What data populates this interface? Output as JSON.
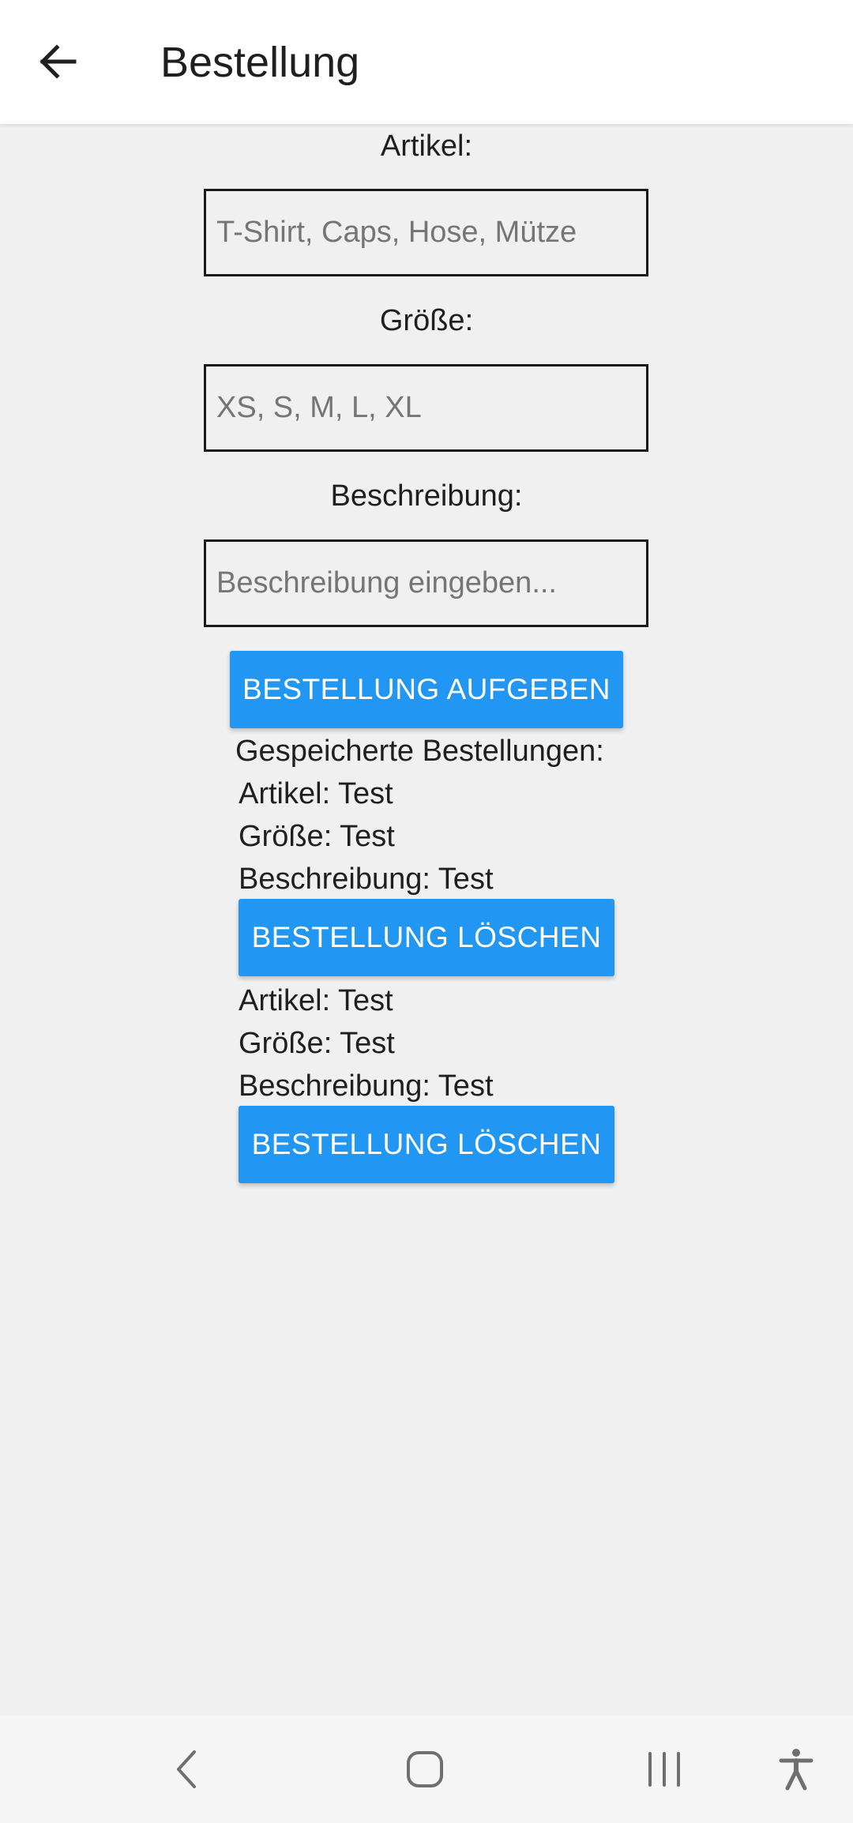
{
  "appbar": {
    "title": "Bestellung",
    "back_icon": "arrow-left-icon"
  },
  "form": {
    "artikel": {
      "label": "Artikel:",
      "placeholder": "T-Shirt, Caps, Hose, Mütze",
      "value": ""
    },
    "groesse": {
      "label": "Größe:",
      "placeholder": "XS, S, M, L, XL",
      "value": ""
    },
    "beschreibung": {
      "label": "Beschreibung:",
      "placeholder": "Beschreibung eingeben...",
      "value": ""
    },
    "submit_label": "BESTELLUNG AUFGEBEN"
  },
  "saved": {
    "heading": "Gespeicherte Bestellungen:",
    "orders": [
      {
        "artikel": "Artikel: Test",
        "groesse": "Größe: Test",
        "beschreibung": "Beschreibung: Test",
        "delete_label": "BESTELLUNG LÖSCHEN"
      },
      {
        "artikel": "Artikel: Test",
        "groesse": "Größe: Test",
        "beschreibung": "Beschreibung: Test",
        "delete_label": "BESTELLUNG LÖSCHEN"
      }
    ]
  },
  "navbar": {
    "icons": [
      "nav-back-icon",
      "home-icon",
      "recent-apps-icon",
      "accessibility-icon"
    ]
  },
  "colors": {
    "accent": "#2196f3",
    "background": "#f0f0f0",
    "appbar": "#ffffff",
    "navbar": "#f5f5f5"
  }
}
